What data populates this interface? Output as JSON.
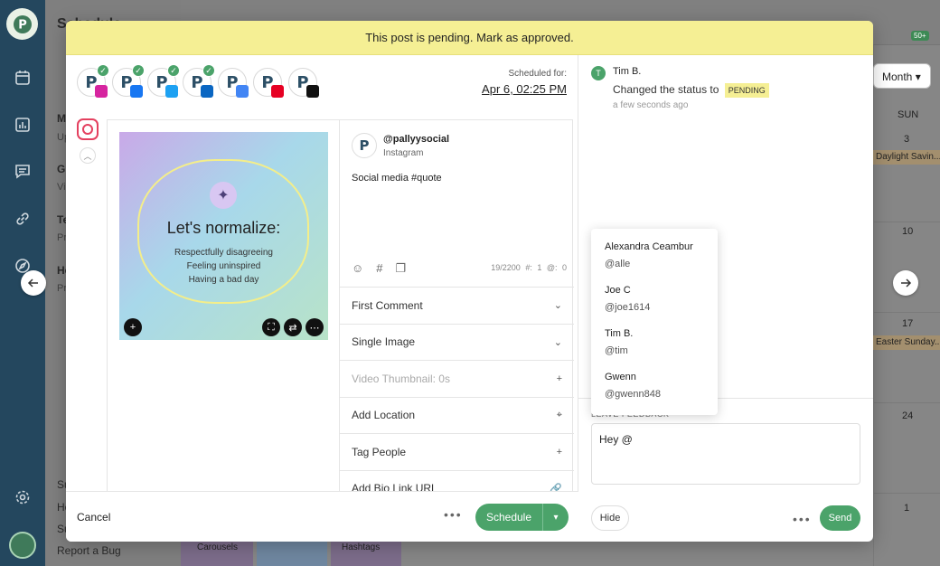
{
  "background": {
    "panel_title": "Schedule",
    "panel_items": [
      {
        "title": "M",
        "sub": "Up"
      },
      {
        "title": "Gr",
        "sub": "Vi"
      },
      {
        "title": "Te",
        "sub": "Pr"
      },
      {
        "title": "He",
        "sub": "Pr"
      }
    ],
    "sidebar_links": [
      "Su",
      "He",
      "Su",
      "Report a Bug"
    ],
    "month_label": "Month",
    "weekday": "SUN",
    "days": [
      "3",
      "10",
      "17",
      "24",
      "1"
    ],
    "events": [
      "Daylight Savin...",
      "Easter Sunday..."
    ],
    "thumb_labels": [
      "Carousels",
      "Hashtags"
    ],
    "notif_badge": "50+"
  },
  "banner": {
    "text": "This post is pending. Mark as approved."
  },
  "accounts": [
    {
      "name": "instagram-account",
      "network_color": "#d6249f",
      "network": "instagram",
      "checked": true
    },
    {
      "name": "facebook-account",
      "network_color": "#1877f2",
      "network": "facebook",
      "checked": true
    },
    {
      "name": "twitter-account",
      "network_color": "#1da1f2",
      "network": "twitter",
      "checked": true
    },
    {
      "name": "linkedin-account",
      "network_color": "#0a66c2",
      "network": "linkedin",
      "checked": true
    },
    {
      "name": "google-account",
      "network_color": "#4285f4",
      "network": "google-business",
      "checked": false
    },
    {
      "name": "pinterest-account",
      "network_color": "#e60023",
      "network": "pinterest",
      "checked": false
    },
    {
      "name": "tiktok-account",
      "network_color": "#111111",
      "network": "tiktok",
      "checked": false
    }
  ],
  "schedule": {
    "label": "Scheduled for:",
    "datetime": "Apr 6, 02:25 PM"
  },
  "media": {
    "title": "Let's normalize:",
    "lines": [
      "Respectfully disagreeing",
      "Feeling uninspired",
      "Having a bad day"
    ]
  },
  "profile": {
    "handle": "@pallyysocial",
    "network": "Instagram"
  },
  "caption": "Social media #quote",
  "counts": {
    "chars": "19/2200",
    "hashtags": "#: 1",
    "mentions": "@: 0"
  },
  "options": [
    {
      "label": "First Comment",
      "icon": "chevron-down-icon",
      "dim": false
    },
    {
      "label": "Single Image",
      "icon": "chevron-down-icon",
      "dim": false
    },
    {
      "label": "Video Thumbnail: 0s",
      "icon": "plus-icon",
      "dim": true
    },
    {
      "label": "Add Location",
      "icon": "pin-icon",
      "dim": false
    },
    {
      "label": "Tag People",
      "icon": "plus-icon",
      "dim": false
    },
    {
      "label": "Add Bio Link URL",
      "icon": "link-icon",
      "dim": false
    }
  ],
  "footer": {
    "cancel": "Cancel",
    "schedule": "Schedule"
  },
  "activity": {
    "user": "Tim B.",
    "avatar_letter": "T",
    "text": "Changed the status to",
    "status": "PENDING",
    "time": "a few seconds ago"
  },
  "feedback": {
    "label": "LEAVE FEEDBACK",
    "value": "Hey @",
    "hide": "Hide",
    "send": "Send"
  },
  "mentions": [
    {
      "name": "Alexandra Ceambur",
      "handle": "@alle"
    },
    {
      "name": "Joe C",
      "handle": "@joe1614"
    },
    {
      "name": "Tim B.",
      "handle": "@tim"
    },
    {
      "name": "Gwenn",
      "handle": "@gwenn848"
    }
  ],
  "colors": {
    "accent": "#4ba36a",
    "banner": "#f5ef94",
    "sidebar": "#24475e"
  }
}
